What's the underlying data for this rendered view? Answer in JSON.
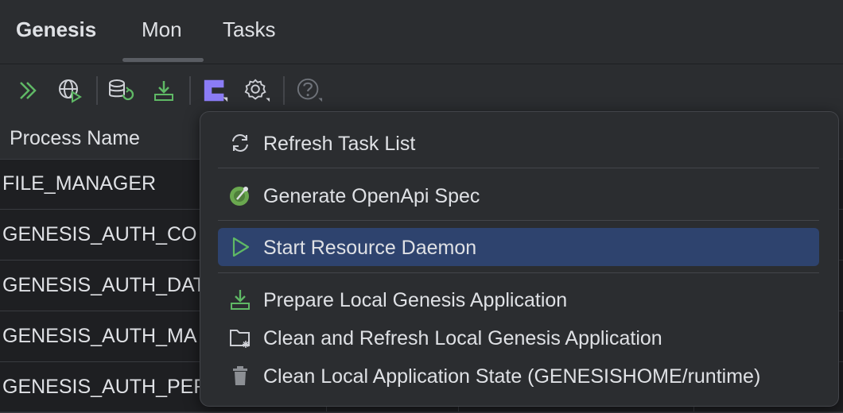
{
  "tabs": [
    {
      "label": "Genesis"
    },
    {
      "label": "Mon"
    },
    {
      "label": "Tasks"
    }
  ],
  "toolbar": {
    "icons": [
      "run-all-icon",
      "web-run-icon",
      "database-refresh-icon",
      "download-icon",
      "genesis-logo-icon",
      "settings-icon",
      "help-icon"
    ]
  },
  "table": {
    "header": "Process Name",
    "rows": [
      "FILE_MANAGER",
      "GENESIS_AUTH_CO",
      "GENESIS_AUTH_DAT",
      "GENESIS_AUTH_MA",
      "GENESIS_AUTH_PER"
    ]
  },
  "menu": {
    "items": [
      {
        "label": "Refresh Task List",
        "icon": "refresh-icon"
      },
      {
        "label": "Generate OpenApi Spec",
        "icon": "openapi-icon"
      },
      {
        "label": "Start Resource Daemon",
        "icon": "play-icon",
        "selected": true
      },
      {
        "label": "Prepare Local Genesis Application",
        "icon": "download-icon"
      },
      {
        "label": "Clean and Refresh Local Genesis Application",
        "icon": "folder-clean-icon"
      },
      {
        "label": "Clean Local Application State (GENESISHOME/runtime)",
        "icon": "trash-icon"
      }
    ]
  },
  "colors": {
    "background": "#2b2d30",
    "table_bg": "#1e1f22",
    "selection": "#2e436e",
    "accent_green": "#5fb865",
    "accent_purple": "#8b7cf6"
  }
}
